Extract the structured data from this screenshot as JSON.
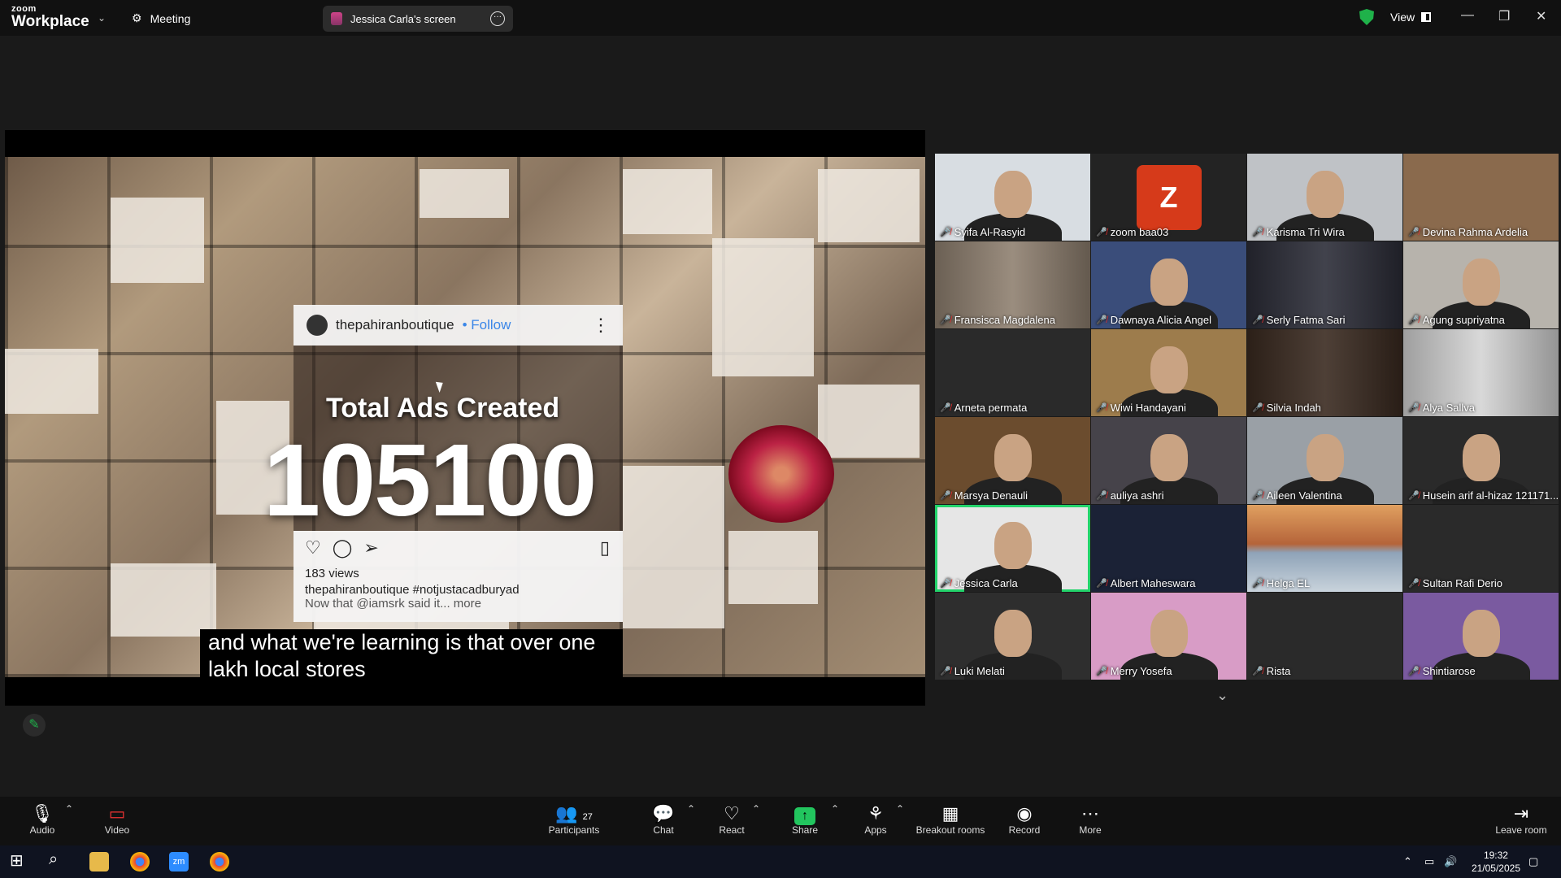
{
  "topbar": {
    "logo_line1": "zoom",
    "logo_line2": "Workplace",
    "meeting_label": "Meeting",
    "share_label": "Jessica Carla's screen",
    "view_label": "View"
  },
  "shared_screen": {
    "post_account": "thepahiranboutique",
    "post_follow": "• Follow",
    "ads_title": "Total Ads Created",
    "ads_number": "105100",
    "post_views": "183 views",
    "post_caption": "thepahiranboutique #notjustacadburyad",
    "post_caption2": "Now that @iamsrk said it... more",
    "subtitle": "and what we're learning is that over one lakh local stores"
  },
  "participants": [
    {
      "name": "Syifa Al-Rasyid",
      "bg": "#d8dde2",
      "type": "person"
    },
    {
      "name": "zoom baa03",
      "bg": "#232323",
      "type": "avatar",
      "initial": "Z"
    },
    {
      "name": "Karisma Tri Wira",
      "bg": "#bfc2c6",
      "type": "person"
    },
    {
      "name": "Devina Rahma Ardelia",
      "bg": "#8a6a4d",
      "type": "wall"
    },
    {
      "name": "Fransisca Magdalena",
      "bg": "#8f8070",
      "type": "room"
    },
    {
      "name": "Dawnaya Alicia Angel",
      "bg": "#3a4d7a",
      "type": "person"
    },
    {
      "name": "Serly Fatma Sari",
      "bg": "#2c2d38",
      "type": "room"
    },
    {
      "name": "Agung supriyatna",
      "bg": "#b7b3ac",
      "type": "person"
    },
    {
      "name": "Arneta permata",
      "bg": "#2a2a2a",
      "type": "dim"
    },
    {
      "name": "Wiwi Handayani",
      "bg": "#9d7c4c",
      "type": "person"
    },
    {
      "name": "Silvia Indah",
      "bg": "#3a2a20",
      "type": "room"
    },
    {
      "name": "Alya Sallva",
      "bg": "#d4d4d4",
      "type": "room"
    },
    {
      "name": "Marsya Denauli",
      "bg": "#6b4c2e",
      "type": "person"
    },
    {
      "name": "auliya ashri",
      "bg": "#46434a",
      "type": "person"
    },
    {
      "name": "Aileen Valentina",
      "bg": "#9aa0a6",
      "type": "person"
    },
    {
      "name": "Husein arif al-hizaz 121171...",
      "bg": "#2a2a2a",
      "type": "person"
    },
    {
      "name": "Jessica Carla",
      "bg": "#e6e6e6",
      "type": "person",
      "active": true
    },
    {
      "name": "Albert Maheswara",
      "bg": "#1b2236",
      "type": "dim"
    },
    {
      "name": "Helga EL",
      "bg": "#c07a45",
      "type": "bridge"
    },
    {
      "name": "Sultan Rafi Derio",
      "bg": "#2a2a2a",
      "type": "dim"
    },
    {
      "name": "Luki Melati",
      "bg": "#2e2e2e",
      "type": "person"
    },
    {
      "name": "Merry Yosefa",
      "bg": "#d89cc6",
      "type": "person"
    },
    {
      "name": "Rista",
      "bg": "#2a2a2a",
      "type": "dim"
    },
    {
      "name": "Shintiarose",
      "bg": "#7a5aa0",
      "type": "person"
    }
  ],
  "toolbar": {
    "audio": "Audio",
    "video": "Video",
    "participants": "Participants",
    "participants_count": "27",
    "chat": "Chat",
    "react": "React",
    "share": "Share",
    "apps": "Apps",
    "breakout": "Breakout rooms",
    "record": "Record",
    "more": "More",
    "leave": "Leave room"
  },
  "taskbar": {
    "time": "19:32",
    "date": "21/05/2025"
  }
}
